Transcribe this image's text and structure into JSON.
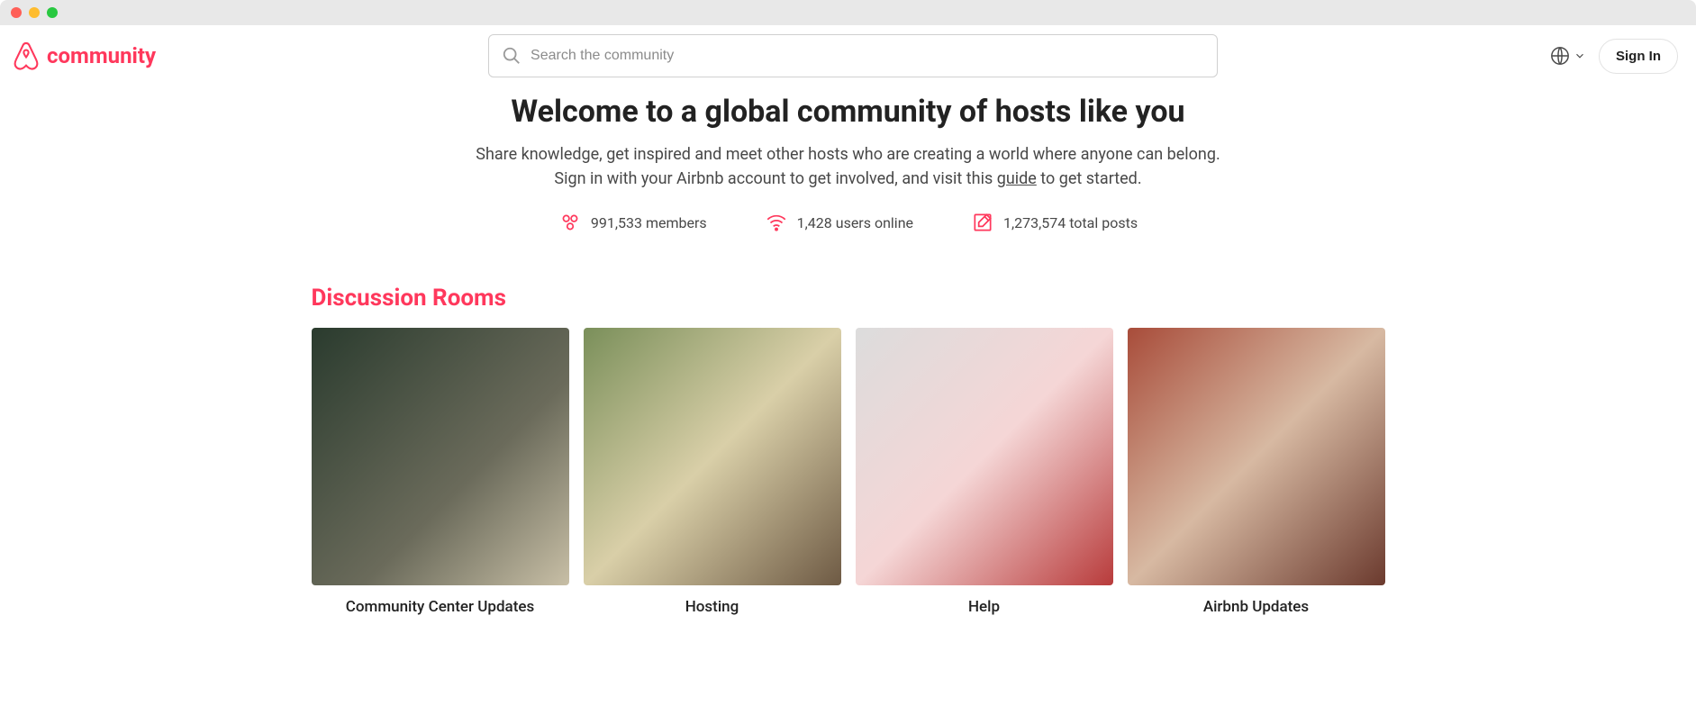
{
  "header": {
    "brand": "community",
    "search_placeholder": "Search the community",
    "signin_label": "Sign In"
  },
  "hero": {
    "title": "Welcome to a global community of hosts like you",
    "line1": "Share knowledge, get inspired and meet other hosts who are creating a world where anyone can belong.",
    "line2_prefix": "Sign in with your Airbnb account to get involved, and visit this ",
    "guide_text": "guide",
    "line2_suffix": " to get started."
  },
  "stats": {
    "members": "991,533 members",
    "users_online": "1,428 users online",
    "total_posts": "1,273,574 total posts"
  },
  "discussion": {
    "title": "Discussion Rooms",
    "cards": [
      {
        "label": "Community Center Updates"
      },
      {
        "label": "Hosting"
      },
      {
        "label": "Help"
      },
      {
        "label": "Airbnb Updates"
      }
    ]
  }
}
